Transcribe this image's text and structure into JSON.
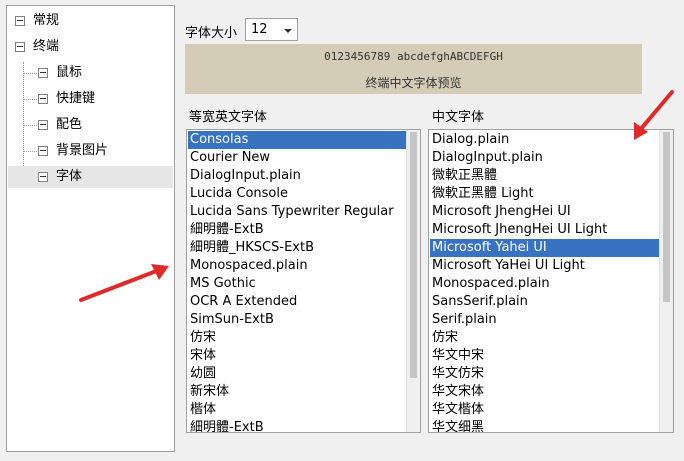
{
  "tree": {
    "items": [
      {
        "label": "常规"
      },
      {
        "label": "终端"
      },
      {
        "label": "鼠标"
      },
      {
        "label": "快捷键"
      },
      {
        "label": "配色"
      },
      {
        "label": "背景图片"
      },
      {
        "label": "字体"
      }
    ]
  },
  "font_size": {
    "label": "字体大小",
    "value": "12"
  },
  "preview": {
    "sample": "0123456789 abcdefghABCDEFGH",
    "chinese": "终端中文字体预览"
  },
  "english_list": {
    "heading": "等宽英文字体",
    "selected": "Consolas",
    "items": [
      "Consolas",
      "Courier New",
      "DialogInput.plain",
      "Lucida Console",
      "Lucida Sans Typewriter Regular",
      "細明體-ExtB",
      "細明體_HKSCS-ExtB",
      "Monospaced.plain",
      "MS Gothic",
      "OCR A Extended",
      "SimSun-ExtB",
      "仿宋",
      "宋体",
      "幼圆",
      "新宋体",
      "楷体",
      "細明體-ExtB"
    ]
  },
  "chinese_list": {
    "heading": "中文字体",
    "selected": "Microsoft Yahei UI",
    "items": [
      "Dialog.plain",
      "DialogInput.plain",
      "微軟正黑體",
      "微軟正黑體 Light",
      "Microsoft JhengHei UI",
      "Microsoft JhengHei UI Light",
      "Microsoft Yahei UI",
      "Microsoft YaHei UI Light",
      "Monospaced.plain",
      "SansSerif.plain",
      "Serif.plain",
      "仿宋",
      "华文中宋",
      "华文仿宋",
      "华文宋体",
      "华文楷体",
      "华文细黑"
    ]
  },
  "colors": {
    "selection": "#3873c2",
    "preview_bg": "#d4ccb6",
    "arrow": "#e02a2a"
  }
}
